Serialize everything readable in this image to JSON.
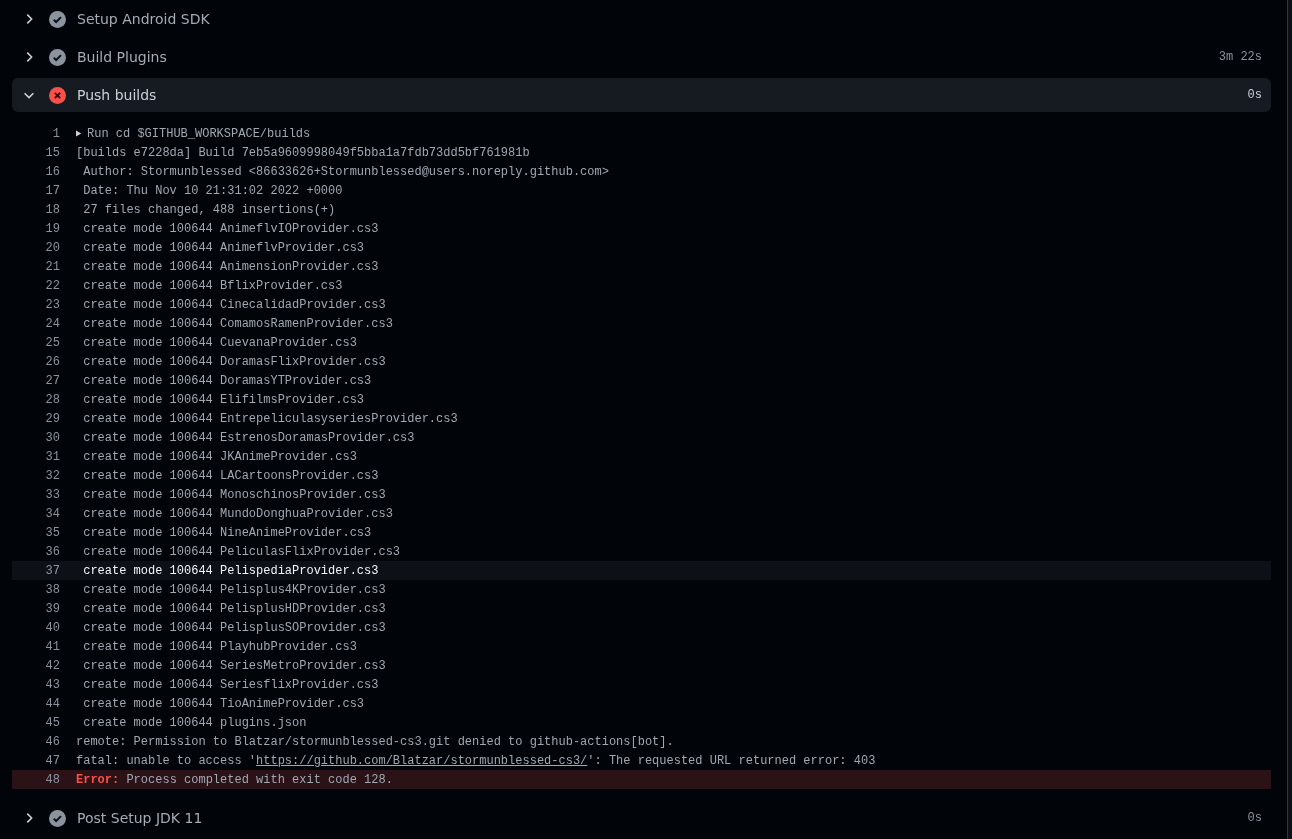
{
  "steps_before": [
    {
      "name": "Setup Android SDK",
      "failed": false,
      "expanded": false
    },
    {
      "name": "Build Plugins",
      "failed": false,
      "expanded": false,
      "duration": "3m 22s"
    },
    {
      "name": "Push builds",
      "failed": true,
      "expanded": true,
      "duration": "0s"
    }
  ],
  "log": [
    {
      "number": "1",
      "kind": "group",
      "text": "Run cd $GITHUB_WORKSPACE/builds",
      "selected": false
    },
    {
      "number": "15",
      "kind": "plain",
      "text": "[builds e7228da] Build 7eb5a9609998049f5bba1a7fdb73dd5bf761981b",
      "selected": false
    },
    {
      "number": "16",
      "kind": "plain",
      "text": " Author: Stormunblessed <86633626+Stormunblessed@users.noreply.github.com>",
      "selected": false
    },
    {
      "number": "17",
      "kind": "plain",
      "text": " Date: Thu Nov 10 21:31:02 2022 +0000",
      "selected": false
    },
    {
      "number": "18",
      "kind": "plain",
      "text": " 27 files changed, 488 insertions(+)",
      "selected": false
    },
    {
      "number": "19",
      "kind": "plain",
      "text": " create mode 100644 AnimeflvIOProvider.cs3",
      "selected": false
    },
    {
      "number": "20",
      "kind": "plain",
      "text": " create mode 100644 AnimeflvProvider.cs3",
      "selected": false
    },
    {
      "number": "21",
      "kind": "plain",
      "text": " create mode 100644 AnimensionProvider.cs3",
      "selected": false
    },
    {
      "number": "22",
      "kind": "plain",
      "text": " create mode 100644 BflixProvider.cs3",
      "selected": false
    },
    {
      "number": "23",
      "kind": "plain",
      "text": " create mode 100644 CinecalidadProvider.cs3",
      "selected": false
    },
    {
      "number": "24",
      "kind": "plain",
      "text": " create mode 100644 ComamosRamenProvider.cs3",
      "selected": false
    },
    {
      "number": "25",
      "kind": "plain",
      "text": " create mode 100644 CuevanaProvider.cs3",
      "selected": false
    },
    {
      "number": "26",
      "kind": "plain",
      "text": " create mode 100644 DoramasFlixProvider.cs3",
      "selected": false
    },
    {
      "number": "27",
      "kind": "plain",
      "text": " create mode 100644 DoramasYTProvider.cs3",
      "selected": false
    },
    {
      "number": "28",
      "kind": "plain",
      "text": " create mode 100644 ElifilmsProvider.cs3",
      "selected": false
    },
    {
      "number": "29",
      "kind": "plain",
      "text": " create mode 100644 EntrepeliculasyseriesProvider.cs3",
      "selected": false
    },
    {
      "number": "30",
      "kind": "plain",
      "text": " create mode 100644 EstrenosDoramasProvider.cs3",
      "selected": false
    },
    {
      "number": "31",
      "kind": "plain",
      "text": " create mode 100644 JKAnimeProvider.cs3",
      "selected": false
    },
    {
      "number": "32",
      "kind": "plain",
      "text": " create mode 100644 LACartoonsProvider.cs3",
      "selected": false
    },
    {
      "number": "33",
      "kind": "plain",
      "text": " create mode 100644 MonoschinosProvider.cs3",
      "selected": false
    },
    {
      "number": "34",
      "kind": "plain",
      "text": " create mode 100644 MundoDonghuaProvider.cs3",
      "selected": false
    },
    {
      "number": "35",
      "kind": "plain",
      "text": " create mode 100644 NineAnimeProvider.cs3",
      "selected": false
    },
    {
      "number": "36",
      "kind": "plain",
      "text": " create mode 100644 PeliculasFlixProvider.cs3",
      "selected": false
    },
    {
      "number": "37",
      "kind": "plain",
      "text": " create mode 100644 PelispediaProvider.cs3",
      "selected": true
    },
    {
      "number": "38",
      "kind": "plain",
      "text": " create mode 100644 Pelisplus4KProvider.cs3",
      "selected": false
    },
    {
      "number": "39",
      "kind": "plain",
      "text": " create mode 100644 PelisplusHDProvider.cs3",
      "selected": false
    },
    {
      "number": "40",
      "kind": "plain",
      "text": " create mode 100644 PelisplusSOProvider.cs3",
      "selected": false
    },
    {
      "number": "41",
      "kind": "plain",
      "text": " create mode 100644 PlayhubProvider.cs3",
      "selected": false
    },
    {
      "number": "42",
      "kind": "plain",
      "text": " create mode 100644 SeriesMetroProvider.cs3",
      "selected": false
    },
    {
      "number": "43",
      "kind": "plain",
      "text": " create mode 100644 SeriesflixProvider.cs3",
      "selected": false
    },
    {
      "number": "44",
      "kind": "plain",
      "text": " create mode 100644 TioAnimeProvider.cs3",
      "selected": false
    },
    {
      "number": "45",
      "kind": "plain",
      "text": " create mode 100644 plugins.json",
      "selected": false
    },
    {
      "number": "46",
      "kind": "plain",
      "text": "remote: Permission to Blatzar/stormunblessed-cs3.git denied to github-actions[bot].",
      "selected": false
    },
    {
      "number": "47",
      "kind": "link",
      "text": "fatal: unable to access '",
      "link": "https://github.com/Blatzar/stormunblessed-cs3/",
      "text_after": "': The requested URL returned error: 403",
      "selected": false
    },
    {
      "number": "48",
      "kind": "error",
      "label": "Error:",
      "text": " Process completed with exit code 128.",
      "selected": false
    }
  ],
  "steps_after": [
    {
      "name": "Post Setup JDK 11",
      "failed": false,
      "expanded": false,
      "duration": "0s"
    }
  ]
}
